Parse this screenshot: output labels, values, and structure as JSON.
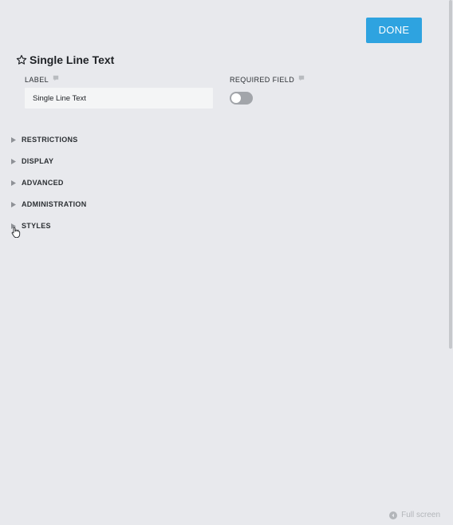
{
  "toolbar": {
    "done_label": "DONE"
  },
  "field": {
    "title": "Single Line Text",
    "label_caption": "LABEL",
    "label_value": "Single Line Text",
    "required_caption": "REQUIRED FIELD",
    "required_enabled": false
  },
  "sections": [
    {
      "label": "RESTRICTIONS"
    },
    {
      "label": "DISPLAY"
    },
    {
      "label": "ADVANCED"
    },
    {
      "label": "ADMINISTRATION"
    },
    {
      "label": "STYLES"
    }
  ],
  "footer": {
    "fullscreen_label": "Full screen"
  },
  "icons": {
    "title": "star-icon",
    "help": "speech-bubble-icon",
    "section": "caret-right-icon",
    "fullscreen": "arrow-circle-icon",
    "cursor": "hand-pointer-icon"
  },
  "colors": {
    "accent": "#2ea3e0",
    "background": "#e8e9ed",
    "toggle_off": "#a2a5aa"
  }
}
